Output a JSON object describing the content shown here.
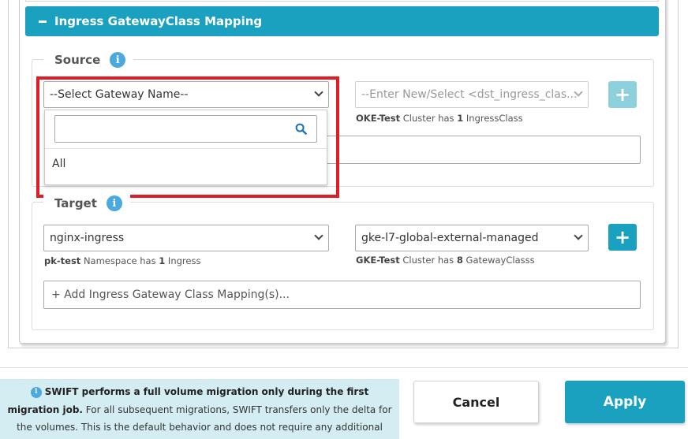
{
  "section": {
    "title": "Ingress GatewayClass Mapping",
    "collapse_icon": "minus-icon"
  },
  "source": {
    "legend": "Source",
    "info_icon": "i",
    "gateway_select": {
      "selected": "--Select Gateway Name--"
    },
    "dropdown": {
      "search_value": "",
      "options": [
        "All"
      ]
    },
    "dst_select": {
      "placeholder": "--Enter New/Select <dst_ingress_clas..."
    },
    "dst_hint": {
      "bold": "OKE-Test",
      "text1": " Cluster has ",
      "count": "1",
      "text2": " IngressClass"
    },
    "add_button": "+"
  },
  "target": {
    "legend": "Target",
    "info_icon": "i",
    "ingress_select": {
      "selected": "nginx-ingress"
    },
    "ingress_hint": {
      "bold": "pk-test",
      "text1": " Namespace has ",
      "count": "1",
      "text2": " Ingress"
    },
    "gateway_class_select": {
      "selected": "gke-l7-global-external-managed"
    },
    "gateway_hint": {
      "bold": "GKE-Test",
      "text1": " Cluster has ",
      "count": "8",
      "text2": " GatewayClasss"
    },
    "add_button": "+",
    "mapping_input": "+ Add Ingress Gateway Class Mapping(s)..."
  },
  "footer": {
    "notice": {
      "info_icon": "i",
      "bold": "SWIFT performs a full volume migration only during the first migration job.",
      "rest": " For all subsequent migrations, SWIFT transfers only the delta for the volumes. This is the default behavior and does not require any additional configuration."
    },
    "cancel_label": "Cancel",
    "apply_label": "Apply"
  },
  "colors": {
    "accent": "#1aa1bf",
    "accent_disabled": "#8fd0dd",
    "info": "#4aa9dd",
    "highlight": "#e01d25",
    "notice_bg": "#d3edf2"
  }
}
